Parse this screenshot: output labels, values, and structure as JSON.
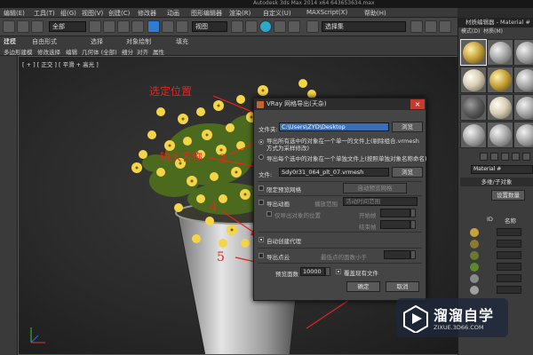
{
  "app": {
    "title": "Autodesk 3ds Max 2014 x64    643653634.max",
    "menu": [
      "编辑(E)",
      "工具(T)",
      "组(G)",
      "视图(V)",
      "创建(C)",
      "修改器",
      "动画",
      "图形编辑器",
      "渲染(R)",
      "自定义(U)",
      "MAXScript(X)",
      "帮助(H)"
    ],
    "toolbar": {
      "filter_select": "全部",
      "view_select": "视图",
      "named_set_select": "选择集"
    },
    "ribbon_tabs": [
      "建模",
      "自由形式",
      "选择",
      "对象绘制",
      "填充"
    ],
    "ribbon_sub": [
      "多边形建模",
      "修改选择",
      "编辑",
      "几何体 (全部)",
      "细分",
      "对齐",
      "属性"
    ]
  },
  "viewport": {
    "label": "[ + ] [ 正交 ] [ 平滑 + 高光 ]"
  },
  "annotations": {
    "step1": "选定位置",
    "step2": "输入名称",
    "step3": "3",
    "step4": "4",
    "step5": "5"
  },
  "dialog": {
    "title": "VRay 网格导出(天杂)",
    "folder_label": "文件夹:",
    "folder_value": "C:\\Users\\ZYD\\Desktop",
    "browse_label": "浏览",
    "option_all_in_one": "导出所有选中的对象在一个单一的文件上(剔除组合.vrmesh 方式为采样修改)",
    "option_each_file": "导出每个选中的对象在一个单独文件上(按照单独对象名称命名)",
    "file_label": "文件:",
    "file_value": "Sdy0r31_064_plt_07.vrmesh",
    "browse2_label": "浏览",
    "auto_preview": "限定预览网格",
    "auto_preview_btn": "自动预览网格",
    "export_anim": "导出动画",
    "anim_range_label": "播放范围",
    "anim_range_value": "活动时间范围",
    "use_prev_pos": "仅导出对象的位置",
    "start_frame": "开始帧",
    "end_frame": "结束帧",
    "auto_create_proxy": "自动创建代理",
    "export_points": "导出点云",
    "points_max_label": "最低点的面数小于",
    "preview_faces_label": "预览面数",
    "preview_faces_value": "10000",
    "overwrite_label": "覆盖现有文件",
    "ok_label": "确定",
    "cancel_label": "取消"
  },
  "material_editor": {
    "title": "材质编辑器 - Material #",
    "menu": [
      "模式(D)",
      "材质(M)"
    ],
    "material_label": "Material #",
    "panel_title": "多维/子对象",
    "set_count_label": "设置数量",
    "id_header": "ID",
    "name_header": "名称"
  },
  "watermark": {
    "brand": "溜溜自学",
    "url": "ZIXUE.3D66.COM"
  },
  "colors": {
    "accent": "#2f7dd3",
    "annotation_red": "#e8241d",
    "dialog_bg": "#454545"
  }
}
